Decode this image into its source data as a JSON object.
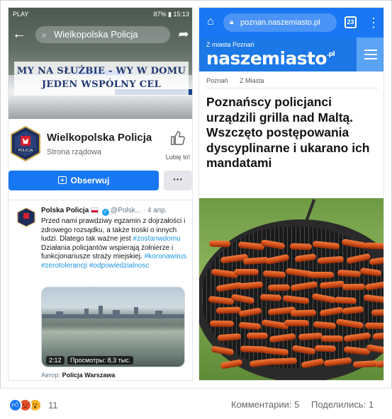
{
  "left_panel": {
    "statusbar": {
      "carrier": "PLAY",
      "indicators": "87% ▮ 15:13"
    },
    "search_text": "Wielkopolska Policja",
    "banner_line1": "MY NA SŁUŻBIE - WY W DOMU",
    "banner_line2": "JEDEN WSPÓLNY CEL",
    "page_name": "Wielkopolska Policja",
    "page_type": "Strona rządowa",
    "like_label": "Lubię to!",
    "follow_label": "Obserwuj",
    "more_label": "···",
    "tweet": {
      "name": "Polska Policja",
      "handle": "@Polsk...",
      "date": "· 4 апр.",
      "text_1": "Przed nami prawdziwy egzamin z dojrzałości i zdrowego rozsądku, a także troski o innych ludzi. Dlatego tak ważne jest ",
      "tag_1": "#zostanwdomu",
      "text_2": " Działania policjantów wspierają żołnierze i funkcjonariusze straży miejskiej. ",
      "tag_2": "#koronawirus",
      "tag_3": "#zerotolerancji",
      "tag_4": "#odpowiedzialnosc",
      "video_time": "2:12",
      "video_views": "Просмотры: 8,3 тыс.",
      "author_label": "Автор:",
      "author_name": "Policja Warszawa"
    }
  },
  "right_panel": {
    "url": "poznan.naszemiasto.pl",
    "tab_count": "23",
    "site_sub": "Z miasta Poznań",
    "logo_text": "naszemiasto",
    "logo_suffix": ".pl",
    "crumbs": [
      "Poznań",
      "Z Miasta"
    ],
    "headline": "Poznańscy policjanci urządzili grilla nad Maltą. Wszczęto postępowania dyscyplinarne i ukarano ich mandatami"
  },
  "footer": {
    "reaction_count": "11",
    "comments": "Комментарии: 5",
    "shares": "Поделились: 1"
  },
  "colors": {
    "facebook_blue": "#1877f2",
    "site_blue": "#1c78e6",
    "chrome_blue": "#1977f3"
  },
  "icons": [
    "back-arrow-icon",
    "search-icon",
    "share-icon",
    "thumbs-up-icon",
    "messenger-plus-icon",
    "home-icon",
    "lock-icon",
    "tabs-icon",
    "kebab-menu-icon",
    "hamburger-icon",
    "like-reaction-icon",
    "angry-reaction-icon",
    "wow-reaction-icon"
  ]
}
